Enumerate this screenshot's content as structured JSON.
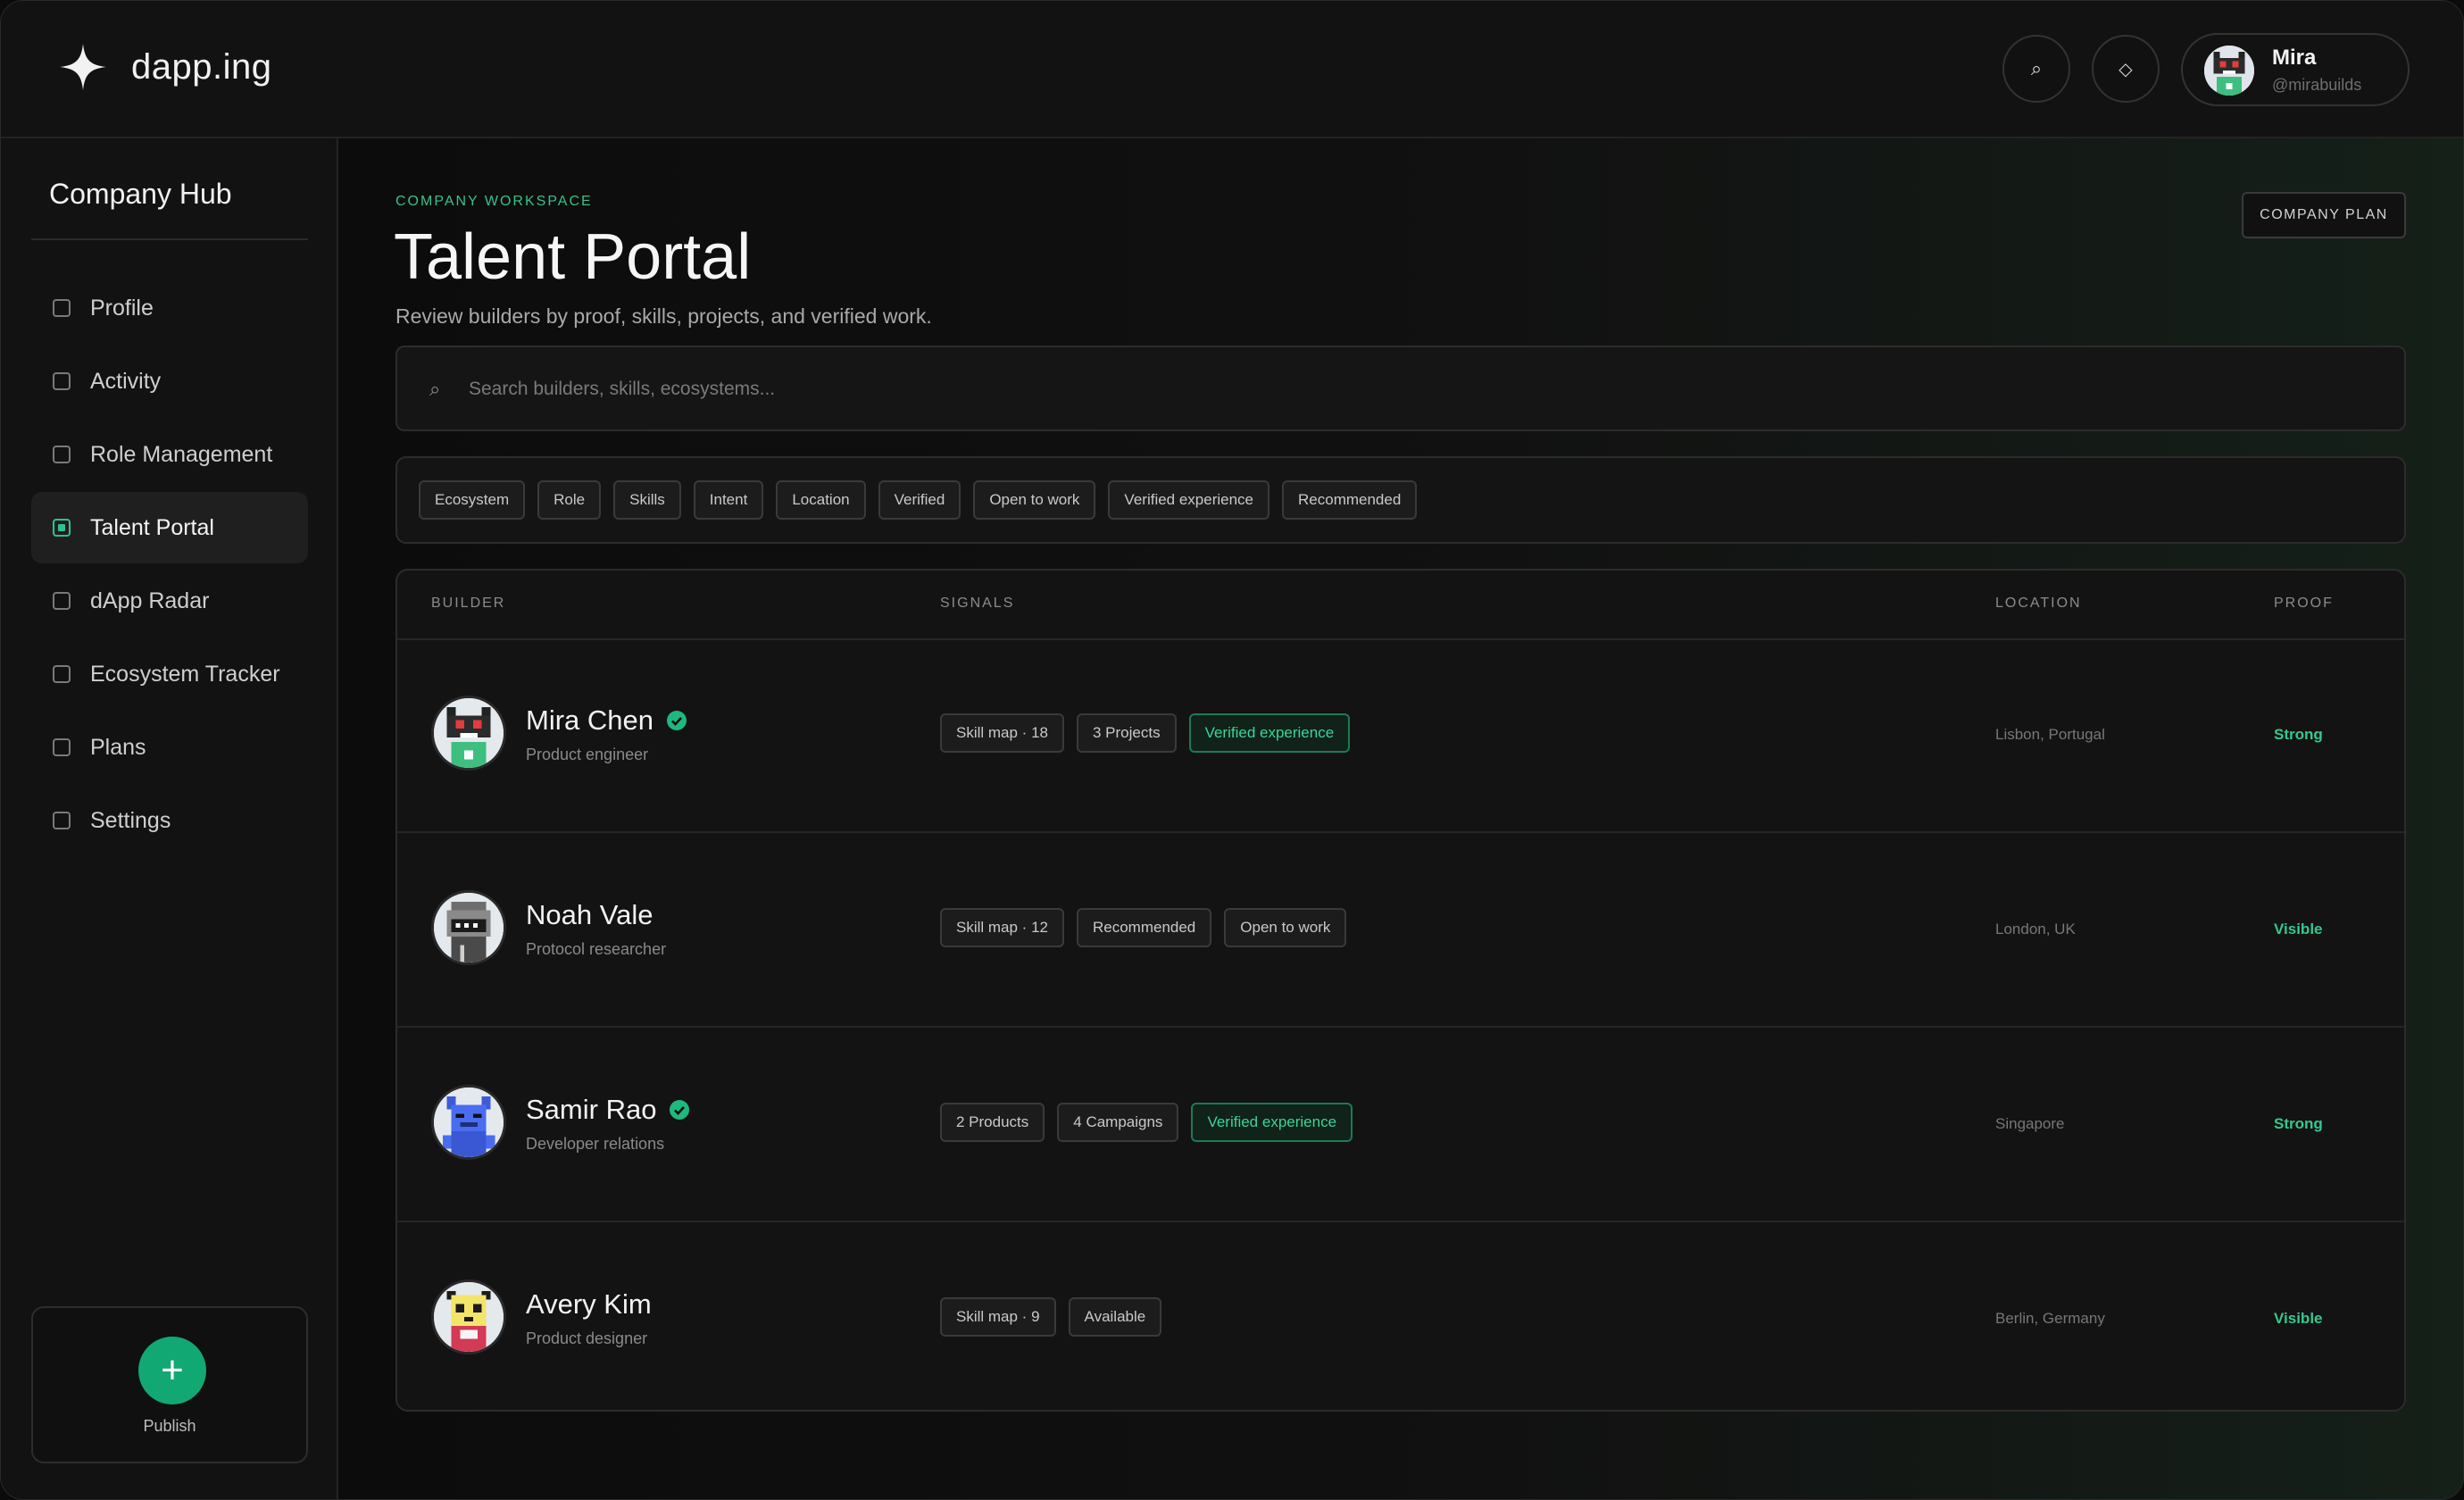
{
  "header": {
    "logo_text": "dapp.ing",
    "search_icon": "search-icon",
    "wallet_icon": "diamond-icon",
    "user": {
      "name": "Mira",
      "handle": "@mirabuilds"
    }
  },
  "sidebar": {
    "title": "Company Hub",
    "items": [
      {
        "label": "Profile",
        "active": false
      },
      {
        "label": "Activity",
        "active": false
      },
      {
        "label": "Role Management",
        "active": false
      },
      {
        "label": "Talent Portal",
        "active": true
      },
      {
        "label": "dApp Radar",
        "active": false
      },
      {
        "label": "Ecosystem Tracker",
        "active": false
      },
      {
        "label": "Plans",
        "active": false
      },
      {
        "label": "Settings",
        "active": false
      }
    ],
    "publish_label": "Publish"
  },
  "main": {
    "eyebrow": "COMPANY WORKSPACE",
    "title": "Talent Portal",
    "subtitle": "Review builders by proof, skills, projects, and verified work.",
    "plan_button": "COMPANY PLAN",
    "search": {
      "placeholder": "Search builders, skills, ecosystems...",
      "value": ""
    },
    "filters": [
      "Ecosystem",
      "Role",
      "Skills",
      "Intent",
      "Location",
      "Verified",
      "Open to work",
      "Verified experience",
      "Recommended"
    ],
    "table": {
      "columns": {
        "builder": "BUILDER",
        "signals": "SIGNALS",
        "location": "LOCATION",
        "proof": "PROOF"
      },
      "rows": [
        {
          "name": "Mira Chen",
          "verified": true,
          "role": "Product engineer",
          "signals": [
            {
              "label": "Skill map · 18",
              "verified": false
            },
            {
              "label": "3 Projects",
              "verified": false
            },
            {
              "label": "Verified experience",
              "verified": true
            }
          ],
          "location": "Lisbon, Portugal",
          "proof": "Strong"
        },
        {
          "name": "Noah Vale",
          "verified": false,
          "role": "Protocol researcher",
          "signals": [
            {
              "label": "Skill map · 12",
              "verified": false
            },
            {
              "label": "Recommended",
              "verified": false
            },
            {
              "label": "Open to work",
              "verified": false
            }
          ],
          "location": "London, UK",
          "proof": "Visible"
        },
        {
          "name": "Samir Rao",
          "verified": true,
          "role": "Developer relations",
          "signals": [
            {
              "label": "2 Products",
              "verified": false
            },
            {
              "label": "4 Campaigns",
              "verified": false
            },
            {
              "label": "Verified experience",
              "verified": true
            }
          ],
          "location": "Singapore",
          "proof": "Strong"
        },
        {
          "name": "Avery Kim",
          "verified": false,
          "role": "Product designer",
          "signals": [
            {
              "label": "Skill map · 9",
              "verified": false
            },
            {
              "label": "Available",
              "verified": false
            }
          ],
          "location": "Berlin, Germany",
          "proof": "Visible"
        }
      ]
    }
  },
  "colors": {
    "accent": "#2fc28c",
    "publish": "#12a873",
    "background": "#0f0f0f"
  }
}
